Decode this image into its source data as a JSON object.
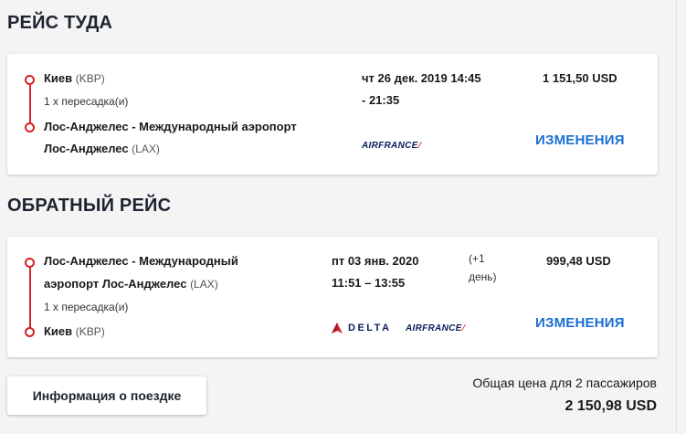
{
  "outbound": {
    "section_title": "РЕЙС ТУДА",
    "from_city": "Киев",
    "from_code": "(KBP)",
    "stops": "1 x пересадка(и)",
    "to_city_line1": "Лос-Анджелес - Международный аэропорт",
    "to_city_line2": "Лос-Анджелес",
    "to_code": "(LAX)",
    "date_time_line1": "чт 26 дек. 2019 14:45",
    "date_time_line2": "- 21:35",
    "price": "1 151,50 USD",
    "airline1": "AIRFRANCE",
    "changes_label": "ИЗМЕНЕНИЯ"
  },
  "return": {
    "section_title": "ОБРАТНЫЙ РЕЙС",
    "from_city_line1": "Лос-Анджелес - Международный",
    "from_city_line2": "аэропорт Лос-Анджелес",
    "from_code": "(LAX)",
    "stops": "1 x пересадка(и)",
    "to_city": "Киев",
    "to_code": "(KBP)",
    "date_line": "пт 03 янв. 2020",
    "time_line": "11:51 – 13:55",
    "next_day_line1": "(+1",
    "next_day_line2": "день)",
    "price": "999,48 USD",
    "airline1": "DELTA",
    "airline2": "AIRFRANCE",
    "changes_label": "ИЗМЕНЕНИЯ"
  },
  "footer": {
    "info_button": "Информация о поездке",
    "total_label": "Общая цена для 2 пассажиров",
    "total_value": "2 150,98 USD"
  },
  "colors": {
    "accent_red": "#d2232a",
    "link_blue": "#1a6fd1",
    "navy": "#0a1f5c"
  }
}
